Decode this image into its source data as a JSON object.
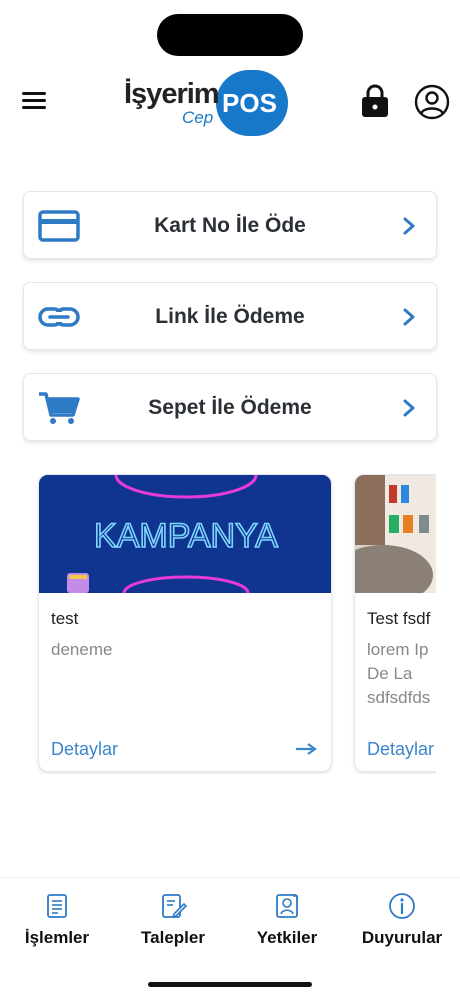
{
  "header": {
    "logo_main": "İşyerim",
    "logo_sub": "Cep",
    "logo_badge": "POS",
    "menu_icon": "hamburger-icon",
    "lock_icon": "lock-icon",
    "user_icon": "user-circle-icon"
  },
  "actions": [
    {
      "label": "Kart No İle Öde",
      "icon": "credit-card-icon"
    },
    {
      "label": "Link İle Ödeme",
      "icon": "link-icon"
    },
    {
      "label": "Sepet İle Ödeme",
      "icon": "cart-icon"
    }
  ],
  "campaigns": [
    {
      "banner_text": "KAMPANYA",
      "title": "test",
      "description": "deneme",
      "link": "Detaylar"
    },
    {
      "title": "Test fsdf",
      "description": "lorem Ip De La sdfsdfds",
      "link": "Detaylar"
    }
  ],
  "bottom_nav": [
    {
      "label": "İşlemler",
      "icon": "document-list-icon"
    },
    {
      "label": "Talepler",
      "icon": "edit-document-icon"
    },
    {
      "label": "Yetkiler",
      "icon": "permission-badge-icon"
    },
    {
      "label": "Duyurular",
      "icon": "info-circle-icon"
    }
  ],
  "colors": {
    "brand_blue": "#1778c9",
    "icon_blue": "#2f7ac4",
    "link_blue": "#3a86cc",
    "text_dark": "#2b2f36"
  }
}
